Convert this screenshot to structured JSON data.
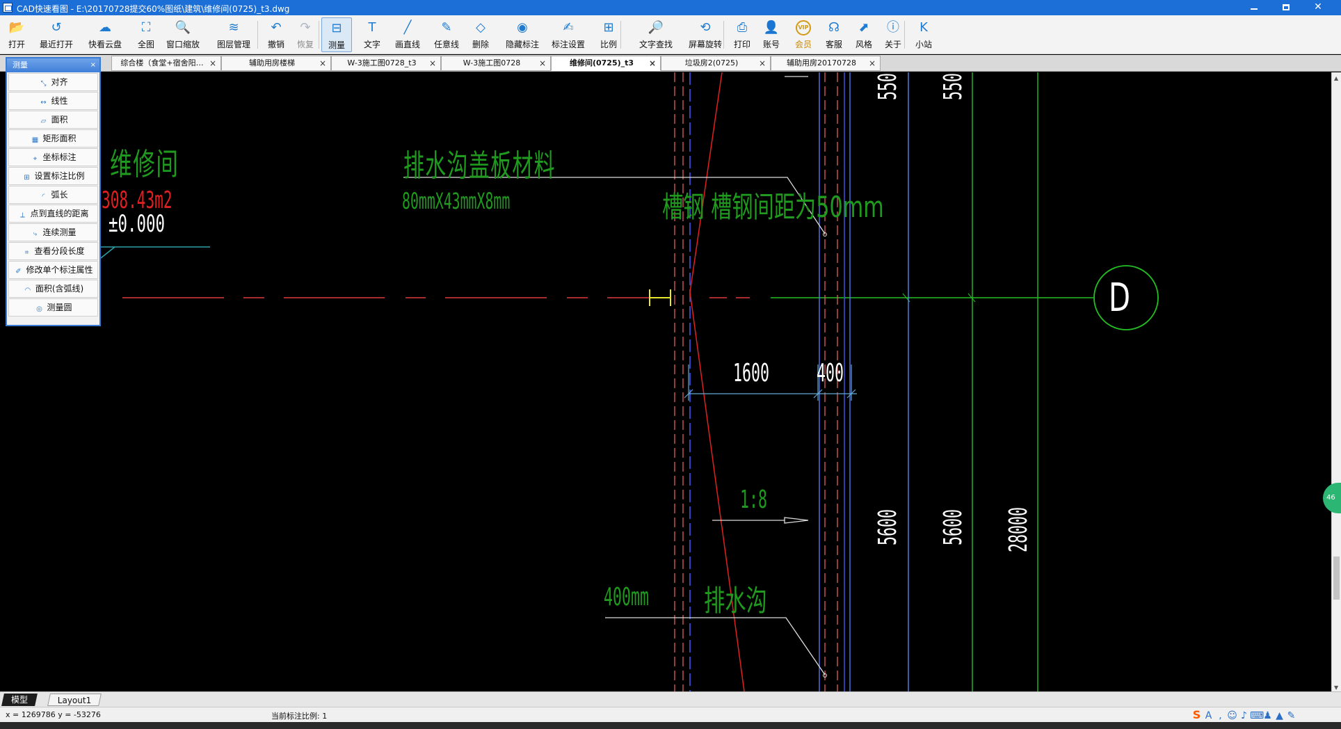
{
  "window": {
    "title": "CAD快速看图 - E:\\20170728提交60%图纸\\建筑\\维修间(0725)_t3.dwg",
    "controls": {
      "minimize": "",
      "maximize": "",
      "close": "✕"
    }
  },
  "toolbar": {
    "items": [
      {
        "label": "打开",
        "icon": "folder-open-icon",
        "glyph": "📂"
      },
      {
        "label": "最近打开",
        "icon": "recent-icon",
        "glyph": "↺"
      },
      {
        "label": "快看云盘",
        "icon": "cloud-icon",
        "glyph": "☁"
      },
      {
        "label": "全图",
        "icon": "fit-all-icon",
        "glyph": "⛶"
      },
      {
        "label": "窗口缩放",
        "icon": "zoom-window-icon",
        "glyph": "🔍"
      },
      {
        "label": "图层管理",
        "icon": "layers-icon",
        "glyph": "≋"
      },
      {
        "label": "撤销",
        "icon": "undo-icon",
        "glyph": "↶"
      },
      {
        "label": "恢复",
        "icon": "redo-icon",
        "glyph": "↷"
      },
      {
        "label": "测量",
        "icon": "measure-icon",
        "glyph": "⊟"
      },
      {
        "label": "文字",
        "icon": "text-icon",
        "glyph": "T"
      },
      {
        "label": "画直线",
        "icon": "line-icon",
        "glyph": "╱"
      },
      {
        "label": "任意线",
        "icon": "freehand-icon",
        "glyph": "✎"
      },
      {
        "label": "删除",
        "icon": "eraser-icon",
        "glyph": "◇"
      },
      {
        "label": "隐藏标注",
        "icon": "hide-icon",
        "glyph": "◉"
      },
      {
        "label": "标注设置",
        "icon": "annotation-settings-icon",
        "glyph": "✍"
      },
      {
        "label": "比例",
        "icon": "scale-icon",
        "glyph": "⊞"
      },
      {
        "label": "文字查找",
        "icon": "text-search-icon",
        "glyph": "🔎"
      },
      {
        "label": "屏幕旋转",
        "icon": "rotate-icon",
        "glyph": "⟲"
      },
      {
        "label": "打印",
        "icon": "print-icon",
        "glyph": "⎙"
      },
      {
        "label": "账号",
        "icon": "account-icon",
        "glyph": "👤"
      },
      {
        "label": "会员",
        "icon": "vip-icon",
        "glyph": "VIP"
      },
      {
        "label": "客服",
        "icon": "headset-icon",
        "glyph": "☊"
      },
      {
        "label": "风格",
        "icon": "style-icon",
        "glyph": "⬈"
      },
      {
        "label": "关于",
        "icon": "info-icon",
        "glyph": "ⓘ"
      },
      {
        "label": "小站",
        "icon": "station-icon",
        "glyph": "K"
      }
    ]
  },
  "tabs": [
    {
      "label": "综合楼（食堂+宿舍阳…"
    },
    {
      "label": "辅助用房楼梯"
    },
    {
      "label": "W-3施工图0728_t3"
    },
    {
      "label": "W-3施工图0728"
    },
    {
      "label": "维修间(0725)_t3",
      "active": true
    },
    {
      "label": "垃圾房2(0725)"
    },
    {
      "label": "辅助用房20170728"
    }
  ],
  "measure_panel": {
    "title": "测量",
    "close": "×",
    "items": [
      {
        "label": "对齐",
        "icon": "align-measure-icon"
      },
      {
        "label": "线性",
        "icon": "linear-measure-icon"
      },
      {
        "label": "面积",
        "icon": "area-measure-icon"
      },
      {
        "label": "矩形面积",
        "icon": "rect-area-icon"
      },
      {
        "label": "坐标标注",
        "icon": "coordinate-icon"
      },
      {
        "label": "设置标注比例",
        "icon": "set-scale-icon"
      },
      {
        "label": "弧长",
        "icon": "arc-length-icon"
      },
      {
        "label": "点到直线的距离",
        "icon": "point-line-distance-icon"
      },
      {
        "label": "连续测量",
        "icon": "continuous-measure-icon"
      },
      {
        "label": "查看分段长度",
        "icon": "segment-length-icon"
      },
      {
        "label": "修改单个标注属性",
        "icon": "edit-annotation-icon"
      },
      {
        "label": "面积(含弧线)",
        "icon": "arc-area-icon"
      },
      {
        "label": "测量圆",
        "icon": "measure-circle-icon"
      }
    ]
  },
  "drawing": {
    "room_name": "维修间",
    "room_area": "308.43m2",
    "elevation": "±0.000",
    "cover_title": "排水沟盖板材料",
    "cover_size": "80mmX43mmX8mm",
    "channel_note": "槽钢 槽钢间距为50mm",
    "dim_1600": "1600",
    "dim_400": "400",
    "slope": "1:8",
    "ditch_width": "400mm",
    "ditch_label": "排水沟",
    "dim_5600a": "5600",
    "dim_5600b": "5600",
    "dim_28000": "28000",
    "top_label_a": "550",
    "top_label_b": "550",
    "axis_label": "D"
  },
  "layout_tabs": [
    {
      "label": "模型"
    },
    {
      "label": "Layout1"
    }
  ],
  "status": {
    "coords": "x = 1269786  y = -53276",
    "scale": "当前标注比例: 1"
  },
  "colors": {
    "green_text": "#1f9a1f",
    "red_text": "#e02020",
    "white_text": "#ffffff",
    "blue_line": "#3a4bd8",
    "cyan_line": "#3f8fb0",
    "title_bar": "#1c6fd6"
  }
}
